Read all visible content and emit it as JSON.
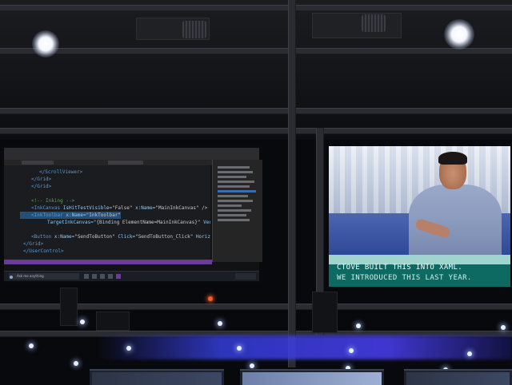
{
  "left_screen": {
    "code_lines": [
      {
        "indent": 2,
        "parts": [
          {
            "k": "tag",
            "t": "</ScrollViewer>"
          }
        ]
      },
      {
        "indent": 1,
        "parts": [
          {
            "k": "tag",
            "t": "</Grid>"
          }
        ]
      },
      {
        "indent": 1,
        "parts": [
          {
            "k": "tag",
            "t": "</Grid>"
          }
        ]
      },
      {
        "indent": 0,
        "parts": []
      },
      {
        "indent": 1,
        "parts": [
          {
            "k": "cmt",
            "t": "<!-- Inking -->"
          }
        ]
      },
      {
        "indent": 1,
        "parts": [
          {
            "k": "tag",
            "t": "<InkCanvas "
          },
          {
            "k": "attr",
            "t": "IsHitTestVisible="
          },
          {
            "k": "val",
            "t": "\"False\" "
          },
          {
            "k": "attr",
            "t": "x:Name="
          },
          {
            "k": "val",
            "t": "\"MainInkCanvas\" />"
          }
        ]
      },
      {
        "indent": 1,
        "highlight": true,
        "parts": [
          {
            "k": "tag",
            "t": "<InkToolbar "
          },
          {
            "k": "attr",
            "t": "x:Name="
          },
          {
            "k": "val",
            "t": "\"InkToolbar\""
          }
        ]
      },
      {
        "indent": 3,
        "parts": [
          {
            "k": "attr",
            "t": "TargetInkCanvas="
          },
          {
            "k": "val",
            "t": "\"{Binding ElementName=MainInkCanvas}\" "
          },
          {
            "k": "attr",
            "t": "VerticalAlignment="
          }
        ]
      },
      {
        "indent": 0,
        "parts": []
      },
      {
        "indent": 1,
        "parts": [
          {
            "k": "tag",
            "t": "<Button "
          },
          {
            "k": "attr",
            "t": "x:Name="
          },
          {
            "k": "val",
            "t": "\"SendToButton\" "
          },
          {
            "k": "attr",
            "t": "Click="
          },
          {
            "k": "val",
            "t": "\"SendToButton_Click\" "
          },
          {
            "k": "attr",
            "t": "HorizontalAlignment="
          }
        ]
      },
      {
        "indent": 0,
        "parts": [
          {
            "k": "tag",
            "t": "</Grid>"
          }
        ]
      },
      {
        "indent": 0,
        "parts": [
          {
            "k": "tag",
            "t": "</UserControl>"
          }
        ]
      }
    ],
    "taskbar_search": "Ask me anything"
  },
  "right_screen": {
    "caption_lines": [
      "CTOVE BUILT THIS INTO XAML.",
      "WE INTRODUCED THIS LAST YEAR."
    ]
  },
  "colors": {
    "caption_bg": "#0c6a63",
    "caption_text": "#ffffff",
    "code_tag": "#569cd6",
    "code_comment": "#57a64a",
    "stage_light": "#3741e6"
  }
}
